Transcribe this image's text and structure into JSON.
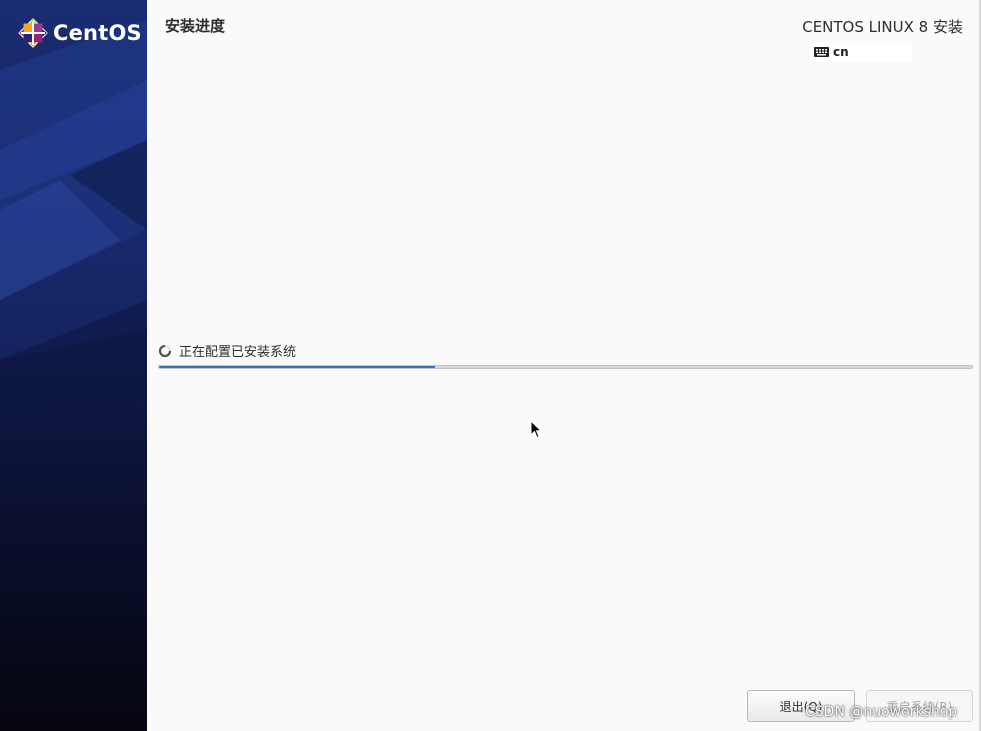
{
  "sidebar": {
    "logo_text": "CentOS"
  },
  "header": {
    "page_title": "安装进度",
    "product_title": "CENTOS LINUX 8 安装",
    "keyboard_layout": "cn"
  },
  "progress": {
    "status_text": "正在配置已安装系统",
    "fraction": 0.34
  },
  "buttons": {
    "quit_label": "退出(Q)",
    "reboot_label": "重启系统(R)"
  },
  "watermark": "CSDN @nuoworkshop",
  "colors": {
    "progress_fill": "#3b72b8",
    "sidebar_top": "#1a2d73",
    "page_background": "#fafafa"
  }
}
